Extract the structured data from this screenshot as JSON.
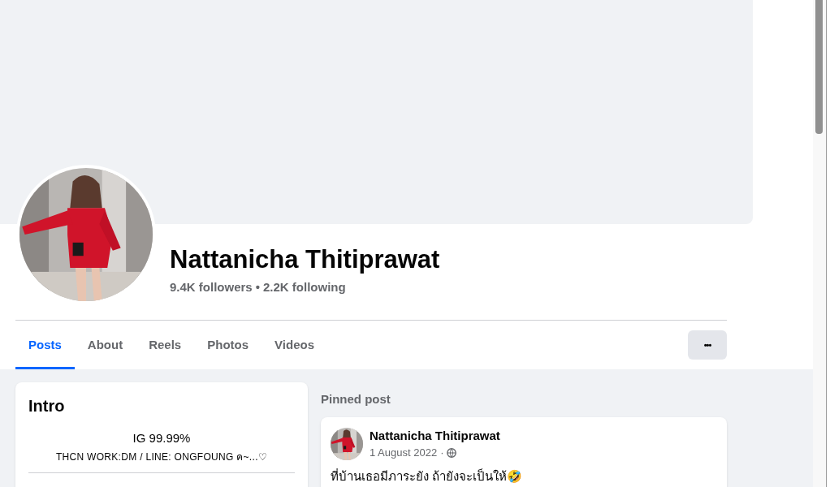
{
  "profile": {
    "name": "Nattanicha Thitiprawat",
    "followers": "9.4K followers",
    "separator": "•",
    "following": "2.2K following"
  },
  "tabs": [
    {
      "label": "Posts",
      "selected": true
    },
    {
      "label": "About",
      "selected": false
    },
    {
      "label": "Reels",
      "selected": false
    },
    {
      "label": "Photos",
      "selected": false
    },
    {
      "label": "Videos",
      "selected": false
    }
  ],
  "more_button": {
    "label": "•••"
  },
  "intro": {
    "title": "Intro",
    "bio_lines": [
      "IG 99.99%",
      "THCN WORK:DM / LINE: ONGFOUNG ค~...♡"
    ]
  },
  "pinned": {
    "heading": "Pinned post",
    "post": {
      "author": "Nattanicha Thitiprawat",
      "date": "1 August 2022",
      "dot": "·",
      "text": "ที่บ้านเธอมีภาระยัง ถ้ายังจะเป็นให้🤣"
    }
  }
}
